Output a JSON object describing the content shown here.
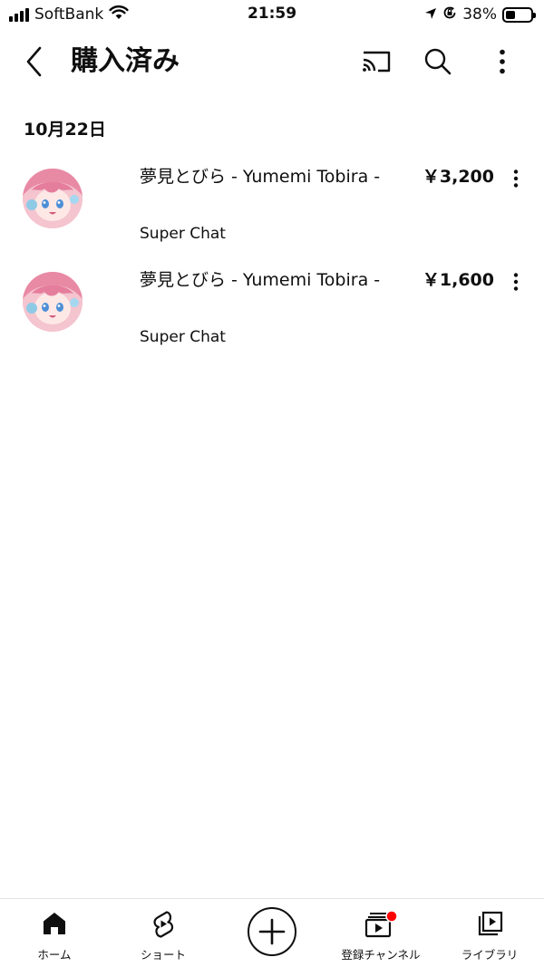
{
  "status_bar": {
    "carrier": "SoftBank",
    "time": "21:59",
    "battery": "38%",
    "battery_level": 0.38,
    "icons": [
      "signal-icon",
      "wifi-icon",
      "location-icon",
      "orientation-lock-icon",
      "battery-icon"
    ]
  },
  "header": {
    "title": "購入済み",
    "icons": [
      "back-icon",
      "cast-icon",
      "search-icon",
      "more-vert-icon"
    ]
  },
  "section": {
    "date": "10月22日"
  },
  "purchases": [
    {
      "title": "夢見とびら - Yumemi Tobira -",
      "type": "Super Chat",
      "price": "￥3,200"
    },
    {
      "title": "夢見とびら - Yumemi Tobira -",
      "type": "Super Chat",
      "price": "￥1,600"
    }
  ],
  "bottom_nav": {
    "items": [
      {
        "label": "ホーム",
        "icon": "home-icon"
      },
      {
        "label": "ショート",
        "icon": "shorts-icon"
      },
      {
        "label": "",
        "icon": "create-icon"
      },
      {
        "label": "登録チャンネル",
        "icon": "subscriptions-icon"
      },
      {
        "label": "ライブラリ",
        "icon": "library-icon"
      }
    ],
    "notification_color": "#ff0000"
  }
}
